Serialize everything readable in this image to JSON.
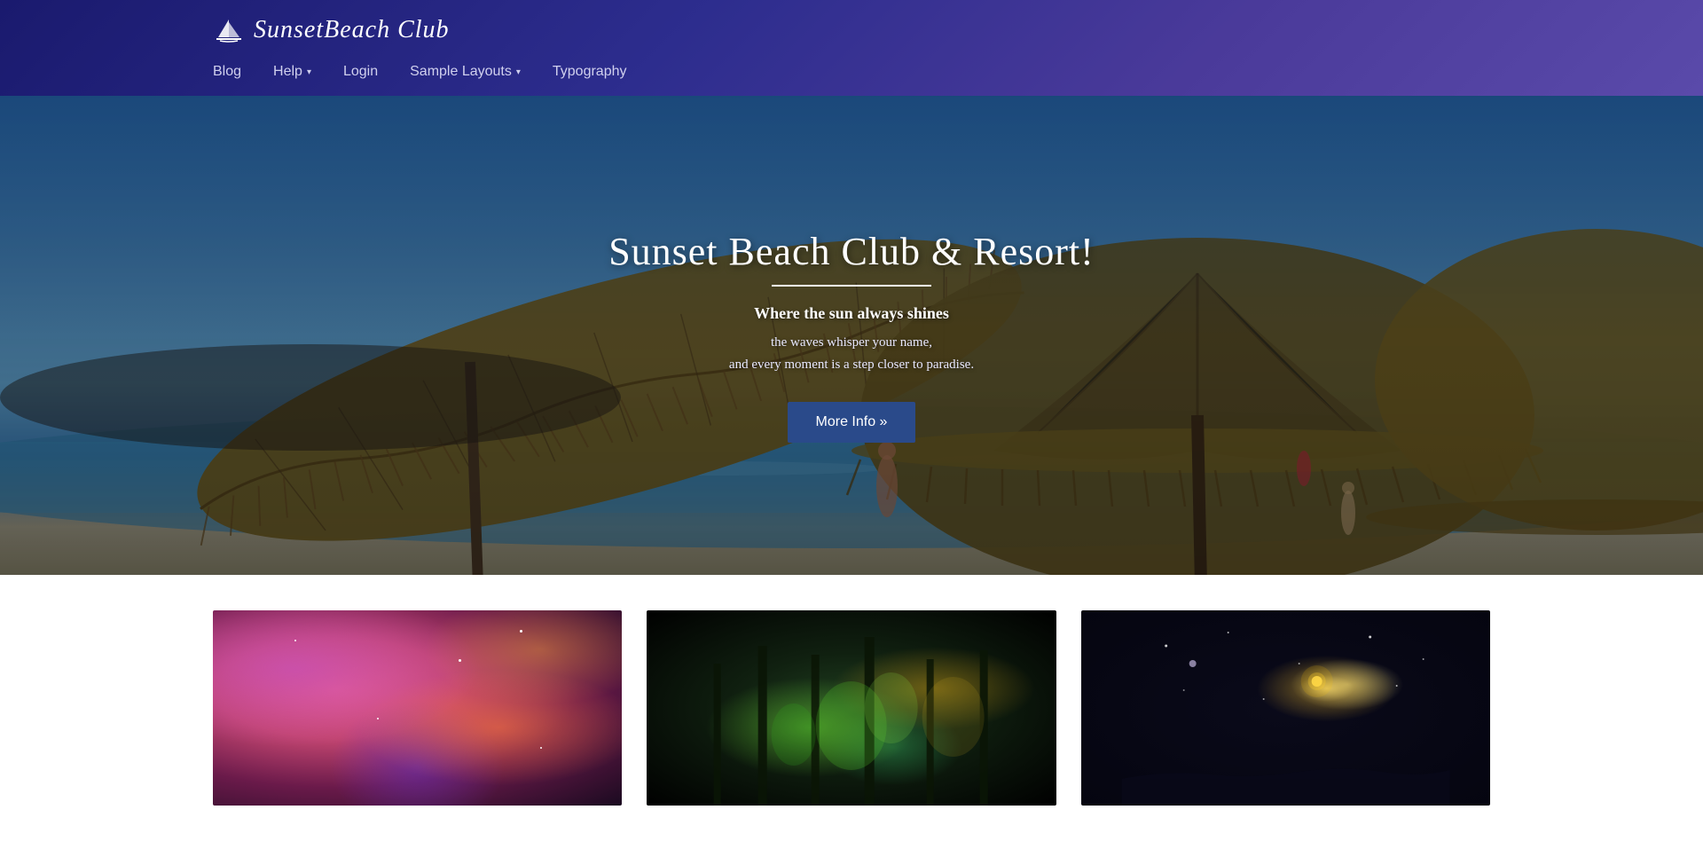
{
  "header": {
    "logo": {
      "text": "SunsetBeach Club",
      "icon_name": "sailboat-icon"
    },
    "nav": {
      "items": [
        {
          "label": "Blog",
          "has_dropdown": false,
          "id": "blog"
        },
        {
          "label": "Help",
          "has_dropdown": true,
          "id": "help"
        },
        {
          "label": "Login",
          "has_dropdown": false,
          "id": "login"
        },
        {
          "label": "Sample Layouts",
          "has_dropdown": true,
          "id": "sample-layouts"
        },
        {
          "label": "Typography",
          "has_dropdown": false,
          "id": "typography"
        }
      ]
    }
  },
  "hero": {
    "title": "Sunset Beach Club & Resort!",
    "divider": true,
    "subtitle": "Where the sun always shines",
    "text_line1": "the waves whisper your name,",
    "text_line2": "and every moment is a step closer to paradise.",
    "button_label": "More Info »"
  },
  "cards": [
    {
      "id": "card-1",
      "alt": "Nebula galaxy card"
    },
    {
      "id": "card-2",
      "alt": "Forest lights card"
    },
    {
      "id": "card-3",
      "alt": "Night stars card"
    }
  ]
}
